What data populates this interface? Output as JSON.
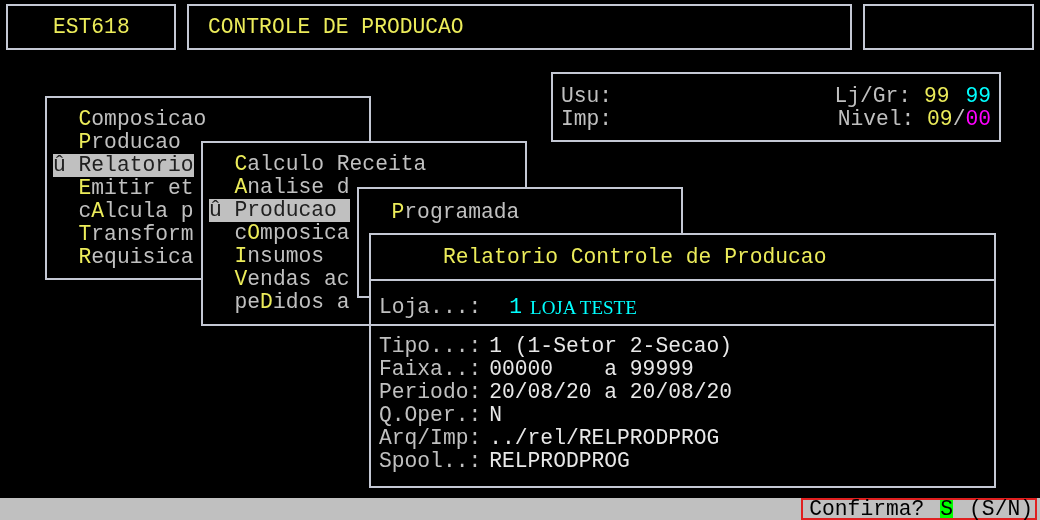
{
  "header": {
    "program_code": "EST618",
    "title": "CONTROLE DE PRODUCAO"
  },
  "info": {
    "user_label": "Usu:",
    "printer_label": "Imp:",
    "store_label": "Lj/Gr:",
    "store": "99",
    "group": "99",
    "level_label": "Nivel:",
    "level": "09",
    "separator": "/",
    "level_2": "00"
  },
  "menus": [
    {
      "items": [
        {
          "label": "**C**omposicao",
          "selected": false
        },
        {
          "label": "**P**roducao",
          "selected": false
        },
        {
          "label": "Relatorio",
          "mark": "û",
          "selected": true
        },
        {
          "label": "**E**mitir et",
          "selected": false
        },
        {
          "label": "c**A**lcula p",
          "selected": false
        },
        {
          "label": "**T**ransform",
          "selected": false
        },
        {
          "label": "**R**equisica",
          "selected": false
        }
      ]
    },
    {
      "items": [
        {
          "label": "**C**alculo Receita",
          "selected": false
        },
        {
          "label": "**A**nalise d",
          "selected": false
        },
        {
          "label": "Producao",
          "mark": "û",
          "selected": true
        },
        {
          "label": "c**O**mposica",
          "selected": false
        },
        {
          "label": "**I**nsumos",
          "selected": false
        },
        {
          "label": "**V**endas ac",
          "selected": false
        },
        {
          "label": "pe**D**idos a",
          "selected": false
        }
      ]
    },
    {
      "items": [
        {
          "label": "**P**rogramada",
          "selected": false
        }
      ]
    }
  ],
  "report": {
    "title": "Relatorio Controle de Producao",
    "store": {
      "label": "Loja...:",
      "code": "1",
      "name": "LOJA TESTE"
    },
    "fields": [
      {
        "label": "Tipo...:",
        "value": "1 (1-Setor 2-Secao)"
      },
      {
        "label": "Faixa..:",
        "value": "00000    a 99999"
      },
      {
        "label": "Periodo:",
        "value": "20/08/20 a 20/08/20"
      },
      {
        "label": "Q.Oper.:",
        "value": "N"
      },
      {
        "label": "Arq/Imp:",
        "value": "../rel/RELPRODPROG"
      },
      {
        "label": "Spool..:",
        "value": "RELPRODPROG"
      }
    ]
  },
  "status_bar": {
    "prompt": "Confirma?",
    "answer": "S",
    "options": "(S/N)"
  }
}
